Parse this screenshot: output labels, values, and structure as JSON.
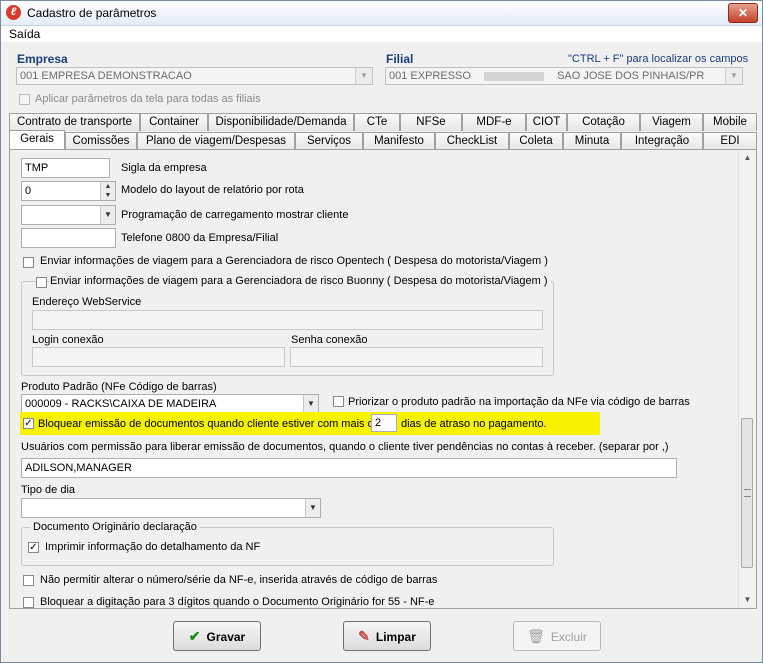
{
  "window": {
    "title": "Cadastro de parâmetros",
    "close_glyph": "✕"
  },
  "menu": {
    "saida": "Saída"
  },
  "empresa": {
    "label": "Empresa",
    "value": "001 EMPRESA DEMONSTRACAO"
  },
  "filial": {
    "label": "Filial",
    "hint": "\"CTRL + F\" para localizar os campos",
    "value_prefix": "001 EXPRESSO",
    "value_suffix": "SAO JOSE DOS PINHAIS/PR"
  },
  "aplicar": {
    "label": "Aplicar parâmetros da tela para todas as filiais"
  },
  "tabs_row1": [
    "Contrato de transporte",
    "Container",
    "Disponibilidade/Demanda",
    "CTe",
    "NFSe",
    "MDF-e",
    "CIOT",
    "Cotação",
    "Viagem",
    "Mobile"
  ],
  "tabs_row2": [
    "Gerais",
    "Comissões",
    "Plano de viagem/Despesas",
    "Serviços",
    "Manifesto",
    "CheckList",
    "Coleta",
    "Minuta",
    "Integração",
    "EDI"
  ],
  "form": {
    "sigla": {
      "value": "TMP",
      "label": "Sigla da empresa"
    },
    "layout": {
      "value": "0",
      "label": "Modelo do layout de relatório por rota"
    },
    "programacao": {
      "value": "",
      "label": "Programação de carregamento mostrar cliente"
    },
    "telefone": {
      "value": "",
      "label": "Telefone 0800 da Empresa/Filial"
    },
    "opentech": {
      "label": "Enviar informações de viagem para a Gerenciadora de risco Opentech ( Despesa do motorista/Viagem )"
    },
    "buonny": {
      "label": "Enviar informações de viagem para a Gerenciadora de risco Buonny ( Despesa do motorista/Viagem )"
    },
    "endereco_ws": {
      "label": "Endereço WebService",
      "value": ""
    },
    "login": {
      "label": "Login conexão",
      "value": ""
    },
    "senha": {
      "label": "Senha conexão",
      "value": ""
    },
    "produto": {
      "label": "Produto Padrão (NFe Código de barras)",
      "value": "000009 - RACKS\\CAIXA DE MADEIRA"
    },
    "priorizar": {
      "label": "Priorizar o produto padrão na importação da NFe via código de barras"
    },
    "bloquear": {
      "label_before": "Bloquear emissão de documentos quando cliente estiver com mais de",
      "days": "2",
      "label_after": "dias de atraso no pagamento."
    },
    "usuarios": {
      "label": "Usuários com permissão para liberar emissão de documentos, quando o cliente tiver pendências no contas à receber. (separar por ,)",
      "value": "ADILSON,MANAGER"
    },
    "tipo_dia": {
      "label": "Tipo de dia",
      "value": ""
    },
    "doc_originario": {
      "label": "Documento Originário declaração",
      "imprimir": "Imprimir informação do detalhamento da NF"
    },
    "nao_permitir": {
      "label": "Não permitir alterar o número/série da NF-e, inserida através de código de barras"
    },
    "bloquear_digitacao": {
      "label": "Bloquear a digitação para 3 dígitos quando o Documento Originário for 55 - NF-e"
    }
  },
  "buttons": {
    "gravar": "Gravar",
    "limpar": "Limpar",
    "excluir": "Excluir"
  },
  "colors": {
    "highlight": "#f6f200",
    "label_blue": "#1a3d7c",
    "gravar_icon": "#1e8a1e"
  }
}
